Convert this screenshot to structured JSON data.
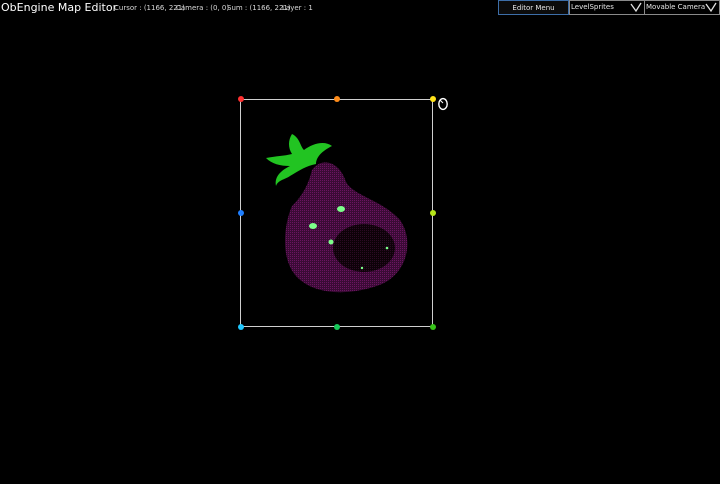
{
  "app": {
    "title": "ObEngine Map Editor"
  },
  "status": {
    "cursor": "Cursor : (1166, 221)",
    "camera": "Camera : (0, 0)",
    "sum": "Sum : (1166, 221)",
    "layer": "Layer : 1"
  },
  "toolbar": {
    "editor_menu_label": "Editor Menu",
    "mode_select_value": "LevelSprites",
    "camera_select_value": "Movable Camera"
  },
  "icons": {
    "mode_arrow": "chevron-down-icon",
    "camera_arrow": "chevron-down-icon",
    "cursor": "mouse-cursor-icon"
  },
  "selection": {
    "border_color": "#cfcfcf",
    "handle_colors": {
      "top_left": "#ff3030",
      "top_middle": "#ff8c1a",
      "top_right": "#ffe21a",
      "middle_left": "#1f7fff",
      "middle_right": "#b6e619",
      "bottom_left": "#1fc8ff",
      "bottom_middle": "#17c95a",
      "bottom_right": "#36c219"
    }
  },
  "sprite": {
    "body_color": "#5a1150",
    "leaf_color": "#22c422",
    "eye_color": "#7cff8a"
  }
}
